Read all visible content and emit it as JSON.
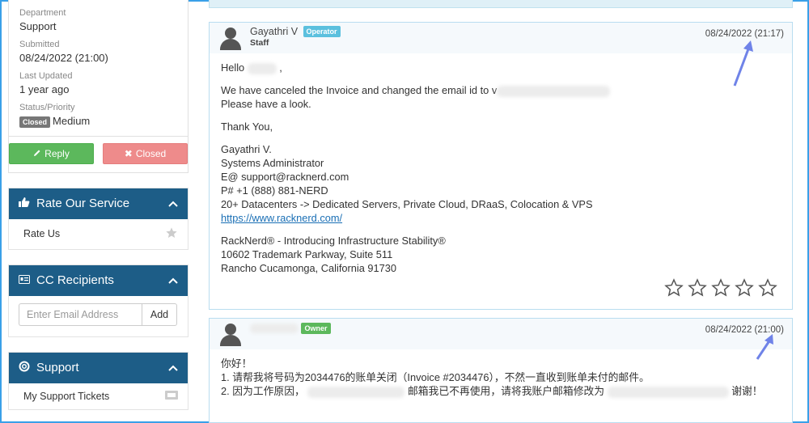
{
  "sidebar": {
    "department_label": "Department",
    "department_value": "Support",
    "submitted_label": "Submitted",
    "submitted_value": "08/24/2022 (21:00)",
    "last_updated_label": "Last Updated",
    "last_updated_value": "1 year ago",
    "status_label": "Status/Priority",
    "status_badge": "Closed",
    "priority_value": "Medium",
    "reply_button": "Reply",
    "closed_button": "Closed",
    "rate_title": "Rate Our Service",
    "rate_item": "Rate Us",
    "cc_title": "CC Recipients",
    "cc_placeholder": "Enter Email Address",
    "cc_add": "Add",
    "support_title": "Support",
    "support_item": "My Support Tickets"
  },
  "messages": [
    {
      "author": "Gayathri V",
      "badge": "Operator",
      "role": "Staff",
      "date": "08/24/2022 (21:17)",
      "lines": {
        "greeting": "Hello",
        "greeting_suffix": ",",
        "line1": "We have canceled the Invoice and changed the email id to v",
        "line2": "Please have a look.",
        "thanks": "Thank You,",
        "sig_name": "Gayathri V.",
        "sig_title": "Systems Administrator",
        "sig_email": "E@ support@racknerd.com",
        "sig_phone": "P# +1 (888) 881-NERD",
        "sig_dc": "20+ Datacenters -> Dedicated Servers, Private Cloud, DRaaS, Colocation & VPS",
        "sig_url": "https://www.racknerd.com/",
        "addr1": "RackNerd® - Introducing Infrastructure Stability®",
        "addr2": "10602 Trademark Parkway, Suite 511",
        "addr3": "Rancho Cucamonga, California 91730"
      },
      "rating_stars": 5
    },
    {
      "badge": "Owner",
      "date": "08/24/2022 (21:00)",
      "lines": {
        "greeting": "你好！",
        "line1": "1. 请帮我将号码为2034476的账单关闭（Invoice #2034476），不然一直收到账单未付的邮件。",
        "line2a": "2. 因为工作原因，",
        "line2b": "邮箱我已不再使用，请将我账户邮箱修改为",
        "line2c": "谢谢！"
      }
    }
  ],
  "colors": {
    "panel_header": "#1d5d87",
    "reply": "#5cb85c",
    "closed": "#ee8b8b",
    "operator_badge": "#5bc0de",
    "owner_badge": "#5cb85c",
    "frame": "#3aa0e8",
    "arrow": "#6f83e8"
  }
}
